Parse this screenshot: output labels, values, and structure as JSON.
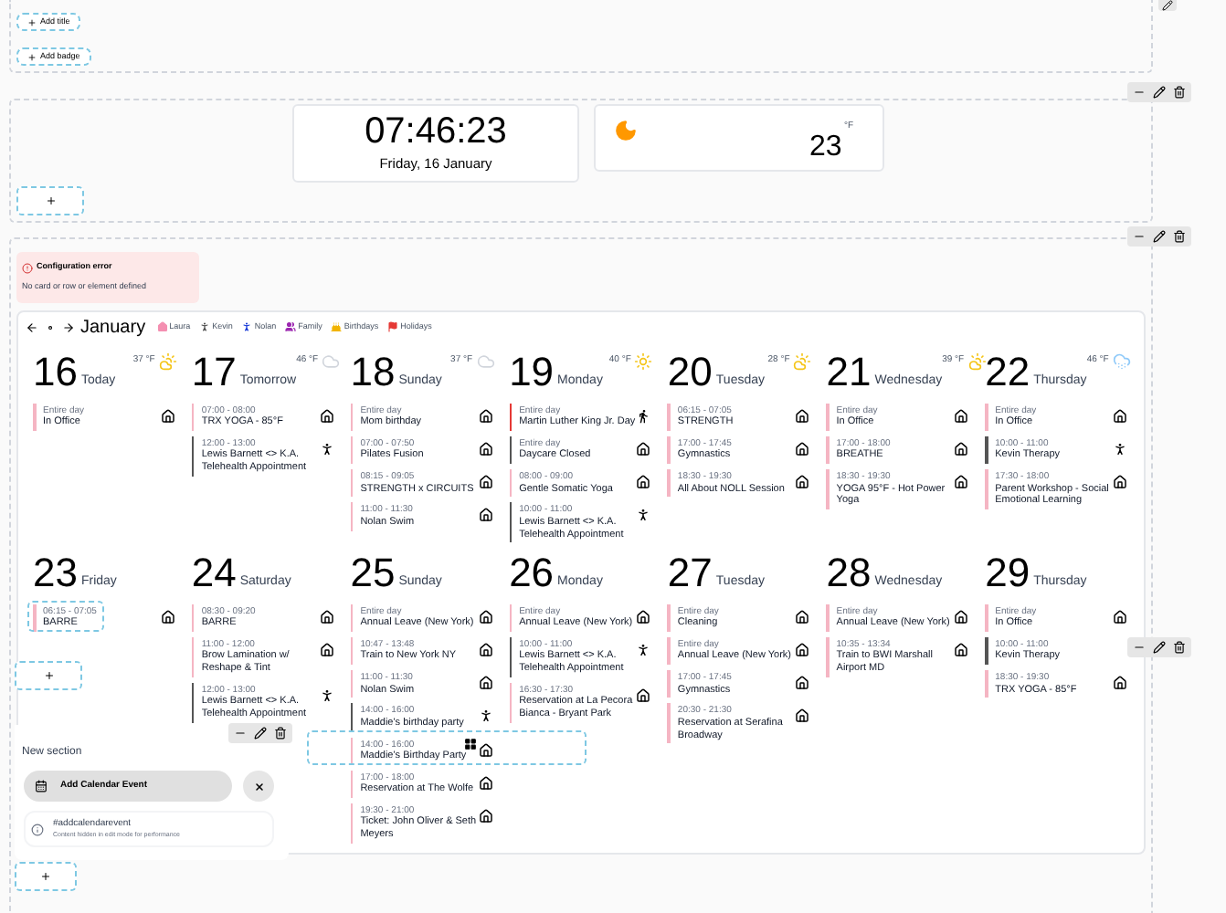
{
  "top_section": {
    "buttons": [
      "Add title",
      "Add badge"
    ]
  },
  "clock": {
    "time": "07:46:23",
    "date": "Friday, 16 January"
  },
  "weather": {
    "unit": "°F",
    "temperature": "23"
  },
  "config_error": {
    "title": "Configuration error",
    "message": "No card or row or element defined"
  },
  "calendar": {
    "month": "January",
    "legend": [
      {
        "label": "Laura",
        "color": "#f48fb1",
        "kind": "house"
      },
      {
        "label": "Kevin",
        "color": "#555555",
        "kind": "person"
      },
      {
        "label": "Nolan",
        "color": "#1e3fd8",
        "kind": "person"
      },
      {
        "label": "Family",
        "color": "#9c27b0",
        "kind": "group"
      },
      {
        "label": "Birthdays",
        "color": "#f2b400",
        "kind": "cake"
      },
      {
        "label": "Holidays",
        "color": "#e53935",
        "kind": "flag"
      }
    ],
    "weeks": [
      [
        {
          "date": "16",
          "name": "Today",
          "temperature": "37 °F",
          "weather": {
            "kind": "sun-cloud"
          },
          "events": [
            {
              "time": "Entire day",
              "title": "In Office",
              "color": "#f5b5c3",
              "kind": "house"
            }
          ]
        },
        {
          "date": "17",
          "name": "Tomorrow",
          "temperature": "46 °F",
          "weather": {
            "kind": "cloud"
          },
          "events": [
            {
              "time": "07:00 - 08:00",
              "title": "TRX YOGA - 85°F",
              "color": "#f5b5c3",
              "kind": "house"
            },
            {
              "time": "12:00 - 13:00",
              "title": "Lewis Barnett <> K.A. Telehealth Appointment",
              "color": "#555555",
              "kind": "person"
            }
          ]
        },
        {
          "date": "18",
          "name": "Sunday",
          "temperature": "37 °F",
          "weather": {
            "kind": "cloud"
          },
          "events": [
            {
              "time": "Entire day",
              "title": "Mom birthday",
              "color": "#f5b5c3",
              "kind": "house"
            },
            {
              "time": "07:00 - 07:50",
              "title": "Pilates Fusion",
              "color": "#f5b5c3",
              "kind": "house"
            },
            {
              "time": "08:15 - 09:05",
              "title": "STRENGTH x CIRCUITS",
              "color": "#f5b5c3",
              "kind": "house"
            },
            {
              "time": "11:00 - 11:30",
              "title": "Nolan Swim",
              "color": "#f5b5c3",
              "kind": "house"
            }
          ]
        },
        {
          "date": "19",
          "name": "Monday",
          "temperature": "40 °F",
          "weather": {
            "kind": "sun"
          },
          "events": [
            {
              "time": "Entire day",
              "title": "Martin Luther King Jr. Day",
              "color": "#e53935",
              "kind": "walk"
            },
            {
              "time": "Entire day",
              "title": "Daycare Closed",
              "color": "#555555",
              "kind": "house"
            },
            {
              "time": "08:00 - 09:00",
              "title": "Gentle Somatic Yoga",
              "color": "#f5b5c3",
              "kind": "house"
            },
            {
              "time": "10:00 - 11:00",
              "title": "Lewis Barnett <> K.A. Telehealth Appointment",
              "color": "#555555",
              "kind": "person"
            }
          ]
        },
        {
          "date": "20",
          "name": "Tuesday",
          "temperature": "28 °F",
          "weather": {
            "kind": "sun-cloud"
          },
          "events": [
            {
              "time": "06:15 - 07:05",
              "title": "STRENGTH",
              "color": "#f5b5c3",
              "kind": "house"
            },
            {
              "time": "17:00 - 17:45",
              "title": "Gymnastics",
              "color": "#f5b5c3",
              "kind": "house"
            },
            {
              "time": "18:30 - 19:30",
              "title": "All About NOLL Session",
              "color": "#f5b5c3",
              "kind": "house"
            }
          ]
        },
        {
          "date": "21",
          "name": "Wednesday",
          "temperature": "39 °F",
          "weather": {
            "kind": "sun-cloud"
          },
          "events": [
            {
              "time": "Entire day",
              "title": "In Office",
              "color": "#f5b5c3",
              "kind": "house"
            },
            {
              "time": "17:00 - 18:00",
              "title": "BREATHE",
              "color": "#f5b5c3",
              "kind": "house"
            },
            {
              "time": "18:30 - 19:30",
              "title": "YOGA 95°F - Hot Power Yoga",
              "color": "#f5b5c3",
              "kind": "house"
            }
          ]
        },
        {
          "date": "22",
          "name": "Thursday",
          "temperature": "46 °F",
          "weather": {
            "kind": "snow"
          },
          "events": [
            {
              "time": "Entire day",
              "title": "In Office",
              "color": "#f5b5c3",
              "kind": "house"
            },
            {
              "time": "10:00 - 11:00",
              "title": "Kevin Therapy",
              "color": "#555555",
              "kind": "person"
            },
            {
              "time": "17:30 - 18:00",
              "title": "Parent Workshop - Social Emotional Learning",
              "color": "#f5b5c3",
              "kind": "house"
            }
          ]
        }
      ],
      [
        {
          "date": "23",
          "name": "Friday",
          "events": [
            {
              "time": "06:15 - 07:05",
              "title": "BARRE",
              "color": "#f5b5c3",
              "kind": "house"
            }
          ]
        },
        {
          "date": "24",
          "name": "Saturday",
          "events": [
            {
              "time": "08:30 - 09:20",
              "title": "BARRE",
              "color": "#f5b5c3",
              "kind": "house"
            },
            {
              "time": "11:00 - 12:00",
              "title": "Brow Lamination w/ Reshape & Tint",
              "color": "#f5b5c3",
              "kind": "house"
            },
            {
              "time": "12:00 - 13:00",
              "title": "Lewis Barnett <> K.A. Telehealth Appointment",
              "color": "#555555",
              "kind": "person"
            }
          ]
        },
        {
          "date": "25",
          "name": "Sunday",
          "events": [
            {
              "time": "Entire day",
              "title": "Annual Leave (New York)",
              "color": "#f5b5c3",
              "kind": "house"
            },
            {
              "time": "10:47 - 13:48",
              "title": "Train to New York NY",
              "color": "#f5b5c3",
              "kind": "house"
            },
            {
              "time": "11:00 - 11:30",
              "title": "Nolan Swim",
              "color": "#f5b5c3",
              "kind": "house"
            },
            {
              "time": "14:00 - 16:00",
              "title": "Maddie's birthday party",
              "color": "#555555",
              "kind": "person"
            },
            {
              "time": "14:00 - 16:00",
              "title": "Maddie's Birthday Party",
              "color": "#f5b5c3",
              "kind": "house"
            },
            {
              "time": "17:00 - 18:00",
              "title": "Reservation at The Wolfe",
              "color": "#f5b5c3",
              "kind": "house"
            },
            {
              "time": "19:30 - 21:00",
              "title": "Ticket: John Oliver & Seth Meyers",
              "color": "#f5b5c3",
              "kind": "house"
            }
          ]
        },
        {
          "date": "26",
          "name": "Monday",
          "events": [
            {
              "time": "Entire day",
              "title": "Annual Leave (New York)",
              "color": "#f5b5c3",
              "kind": "house"
            },
            {
              "time": "10:00 - 11:00",
              "title": "Lewis Barnett <> K.A. Telehealth Appointment",
              "color": "#555555",
              "kind": "person"
            },
            {
              "time": "16:30 - 17:30",
              "title": "Reservation at La Pecora Bianca - Bryant Park",
              "color": "#f5b5c3",
              "kind": "house"
            }
          ]
        },
        {
          "date": "27",
          "name": "Tuesday",
          "events": [
            {
              "time": "Entire day",
              "title": "Cleaning",
              "color": "#f5b5c3",
              "kind": "house"
            },
            {
              "time": "Entire day",
              "title": "Annual Leave (New York)",
              "color": "#f5b5c3",
              "kind": "house"
            },
            {
              "time": "17:00 - 17:45",
              "title": "Gymnastics",
              "color": "#f5b5c3",
              "kind": "house"
            },
            {
              "time": "20:30 - 21:30",
              "title": "Reservation at Serafina Broadway",
              "color": "#f5b5c3",
              "kind": "house"
            }
          ]
        },
        {
          "date": "28",
          "name": "Wednesday",
          "events": [
            {
              "time": "Entire day",
              "title": "Annual Leave (New York)",
              "color": "#f5b5c3",
              "kind": "house"
            },
            {
              "time": "10:35 - 13:34",
              "title": "Train to BWI Marshall Airport MD",
              "color": "#f5b5c3",
              "kind": "house"
            }
          ]
        },
        {
          "date": "29",
          "name": "Thursday",
          "events": [
            {
              "time": "Entire day",
              "title": "In Office",
              "color": "#f5b5c3",
              "kind": "house"
            },
            {
              "time": "10:00 - 11:00",
              "title": "Kevin Therapy",
              "color": "#555555",
              "kind": "none"
            },
            {
              "time": "18:30 - 19:30",
              "title": "TRX YOGA - 85°F",
              "color": "#f5b5c3",
              "kind": "house"
            }
          ]
        }
      ]
    ]
  },
  "new_section": {
    "title": "New section",
    "action": "Add Calendar Event",
    "info_title": "#addcalendarevent",
    "info_message": "Content hidden in edit mode for performance"
  }
}
